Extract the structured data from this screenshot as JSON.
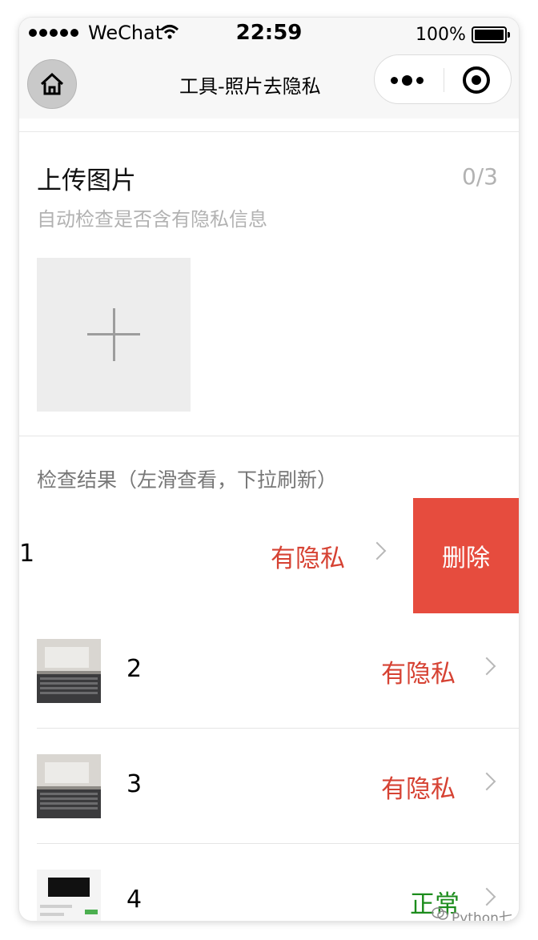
{
  "status_bar": {
    "carrier": "WeChat",
    "time": "22:59",
    "battery": "100%"
  },
  "nav": {
    "title": "工具-照片去隐私",
    "home_icon": "home-icon",
    "more_icon": "more-dots-icon",
    "close_icon": "target-circle-icon"
  },
  "upload": {
    "title": "上传图片",
    "count": "0/3",
    "subtitle": "自动检查是否含有隐私信息",
    "add_icon": "plus-icon"
  },
  "results": {
    "title": "检查结果（左滑查看，下拉刷新）",
    "delete_label": "删除",
    "rows": [
      {
        "index": "1",
        "status": "有隐私",
        "status_color": "#d64233"
      },
      {
        "index": "2",
        "status": "有隐私",
        "status_color": "#d64233"
      },
      {
        "index": "3",
        "status": "有隐私",
        "status_color": "#d64233"
      },
      {
        "index": "4",
        "status": "正常",
        "status_color": "#1c8c1c"
      }
    ]
  },
  "watermark": "Python七号",
  "colors": {
    "danger": "#e64c3e",
    "privacy_red": "#d64233",
    "normal_green": "#1c8c1c",
    "subtle_text": "#b2b2b2"
  }
}
